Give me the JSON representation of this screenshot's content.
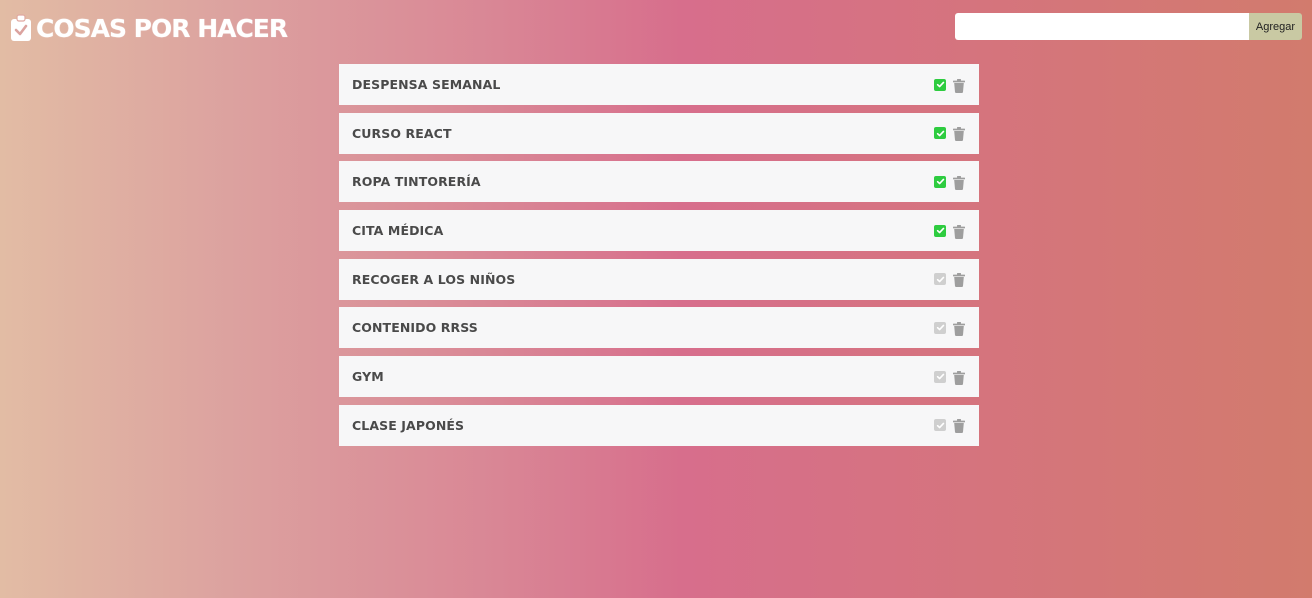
{
  "header": {
    "title": "COSAS POR HACER",
    "icon": "clipboard-check-icon"
  },
  "add_form": {
    "input_value": "",
    "input_placeholder": "",
    "button_label": "Agregar"
  },
  "colors": {
    "done_check": "#2ecc40",
    "pending_check": "#cfcfcf",
    "add_button": "#c9c9a3",
    "trash": "#9e9e9e",
    "item_bg": "#f7f7f8",
    "item_text": "#4a4a4a"
  },
  "tasks": [
    {
      "label": "DESPENSA SEMANAL",
      "done": true
    },
    {
      "label": "CURSO REACT",
      "done": true
    },
    {
      "label": "ROPA TINTORERÍA",
      "done": true
    },
    {
      "label": "CITA MÉDICA",
      "done": true
    },
    {
      "label": "RECOGER A LOS NIÑOS",
      "done": false
    },
    {
      "label": "CONTENIDO RRSS",
      "done": false
    },
    {
      "label": "GYM",
      "done": false
    },
    {
      "label": "CLASE JAPONÉS",
      "done": false
    }
  ]
}
